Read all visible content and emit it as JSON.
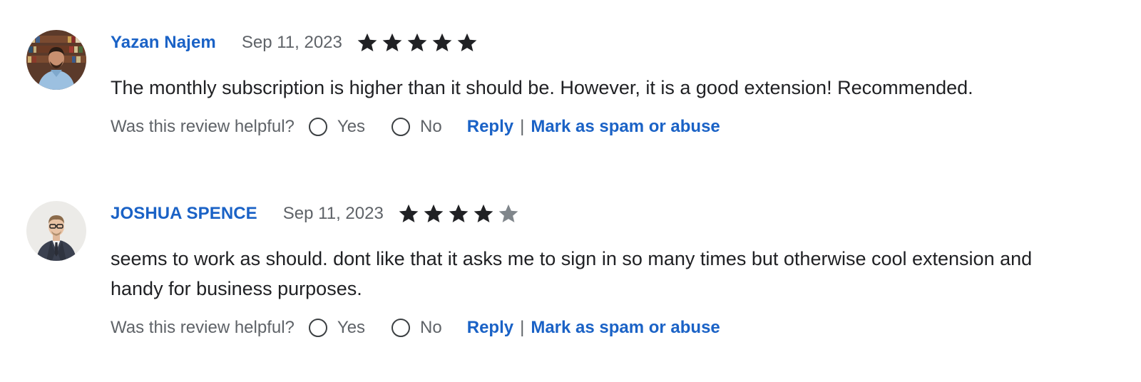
{
  "colors": {
    "link": "#1a62c6",
    "text": "#202124",
    "muted": "#5f6368",
    "star_filled": "#202124",
    "star_empty": "#80868b"
  },
  "reviews": [
    {
      "author": "Yazan Najem",
      "date": "Sep 11, 2023",
      "rating": 5,
      "text": "The monthly subscription is higher than it should be. However, it is a good extension! Recommended.",
      "helpful_prompt": "Was this review helpful?",
      "yes_label": "Yes",
      "no_label": "No",
      "reply_label": "Reply",
      "separator": "|",
      "spam_label": "Mark as spam or abuse"
    },
    {
      "author": "JOSHUA SPENCE",
      "date": "Sep 11, 2023",
      "rating": 4,
      "text": "seems to work as should. dont like that it asks me to sign in so many times but otherwise cool extension and handy for business purposes.",
      "helpful_prompt": "Was this review helpful?",
      "yes_label": "Yes",
      "no_label": "No",
      "reply_label": "Reply",
      "separator": "|",
      "spam_label": "Mark as spam or abuse"
    }
  ]
}
